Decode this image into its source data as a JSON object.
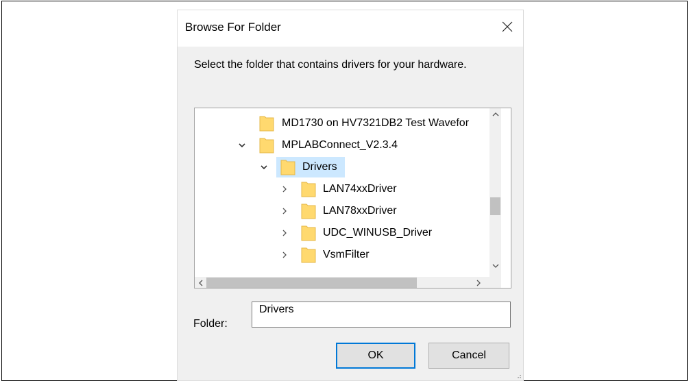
{
  "dialog": {
    "title": "Browse For Folder",
    "instruction": "Select the folder that contains drivers for your hardware."
  },
  "tree": {
    "items": [
      {
        "label": "MD1730 on HV7321DB2 Test Wavefor",
        "expander": "none",
        "selected": false
      },
      {
        "label": "MPLABConnect_V2.3.4",
        "expander": "expanded",
        "selected": false
      },
      {
        "label": "Drivers",
        "expander": "expanded",
        "selected": true
      },
      {
        "label": "LAN74xxDriver",
        "expander": "collapsed",
        "selected": false
      },
      {
        "label": "LAN78xxDriver",
        "expander": "collapsed",
        "selected": false
      },
      {
        "label": "UDC_WINUSB_Driver",
        "expander": "collapsed",
        "selected": false
      },
      {
        "label": "VsmFilter",
        "expander": "collapsed",
        "selected": false
      }
    ]
  },
  "folder": {
    "label": "Folder:",
    "value": "Drivers"
  },
  "buttons": {
    "ok": "OK",
    "cancel": "Cancel"
  },
  "colors": {
    "selection": "#cce8ff",
    "folder_fill": "#ffd96f",
    "folder_edge": "#e6b84a",
    "default_button_border": "#0078d7"
  },
  "icons": {
    "close": "close-icon",
    "folder": "folder-icon",
    "expanded": "chevron-down-icon",
    "collapsed": "chevron-right-icon"
  }
}
